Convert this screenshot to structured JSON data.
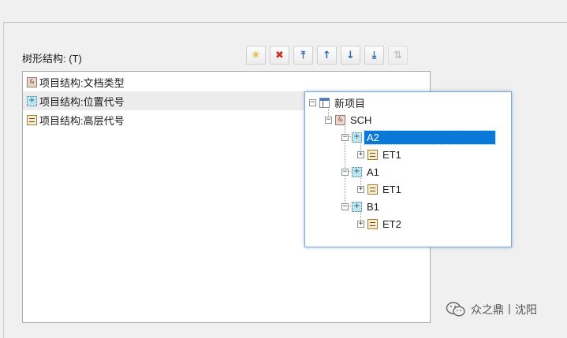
{
  "panel": {
    "label": "树形结构: (T)"
  },
  "toolbar": [
    {
      "name": "new-button",
      "icon": "✳",
      "color": "#e0a000",
      "disabled": false
    },
    {
      "name": "delete-button",
      "icon": "✖",
      "color": "#d03020",
      "disabled": false
    },
    {
      "name": "move-top-button",
      "icon": "⤒",
      "color": "#2a6ab0",
      "disabled": false
    },
    {
      "name": "move-up-button",
      "icon": "↑",
      "color": "#2a6ab0",
      "disabled": false
    },
    {
      "name": "move-down-button",
      "icon": "↓",
      "color": "#2a6ab0",
      "disabled": false
    },
    {
      "name": "move-bottom-button",
      "icon": "⤓",
      "color": "#2a6ab0",
      "disabled": false
    },
    {
      "name": "sort-button",
      "icon": "⇅",
      "color": "#999999",
      "disabled": true
    }
  ],
  "list": {
    "items": [
      {
        "icon": "doc-type-icon",
        "glyph": "&",
        "label": "项目结构:文档类型",
        "hover": false
      },
      {
        "icon": "location-code-icon",
        "glyph": "+",
        "label": "项目结构:位置代号",
        "hover": true
      },
      {
        "icon": "level-code-icon",
        "glyph": "",
        "label": "项目结构:高层代号",
        "hover": false
      }
    ]
  },
  "tree": {
    "root": "新项目",
    "sch": "SCH",
    "a2": "A2",
    "a2_et1": "ET1",
    "a1": "A1",
    "a1_et1": "ET1",
    "b1": "B1",
    "b1_et2": "ET2",
    "selected": "A2"
  },
  "watermark": {
    "text": "众之鼎丨沈阳"
  }
}
